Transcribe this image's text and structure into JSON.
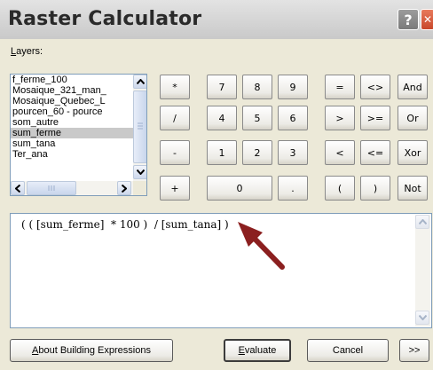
{
  "window": {
    "title": "Raster Calculator",
    "help_glyph": "?",
    "close_glyph": "✕"
  },
  "layers": {
    "label_accel": "L",
    "label_rest": "ayers:",
    "items": [
      "f_ferme_100",
      "Mosaique_321_man_",
      "Mosaique_Quebec_L",
      "pourcen_60 - pource",
      "som_autre",
      "sum_ferme",
      "sum_tana",
      "Ter_ana"
    ],
    "selected_item": "sum_ferme"
  },
  "keypad": {
    "operators_left": [
      "*",
      "/",
      "-",
      "+"
    ],
    "digits_row1": [
      "7",
      "8",
      "9"
    ],
    "digits_row2": [
      "4",
      "5",
      "6"
    ],
    "digits_row3": [
      "1",
      "2",
      "3"
    ],
    "zero": "0",
    "dot": ".",
    "compare_col1": [
      "=",
      ">",
      "<",
      "("
    ],
    "compare_col2": [
      "<>",
      ">=",
      "<=",
      ")"
    ],
    "logic": [
      "And",
      "Or",
      "Xor",
      "Not"
    ]
  },
  "expression": {
    "text": "( ( [sum_ferme]  * 100 )  / [sum_tana] )"
  },
  "footer": {
    "about_accel": "A",
    "about_rest": "bout Building Expressions",
    "evaluate_accel": "E",
    "evaluate_rest": "valuate",
    "cancel_label": "Cancel",
    "more_label": ">>"
  }
}
